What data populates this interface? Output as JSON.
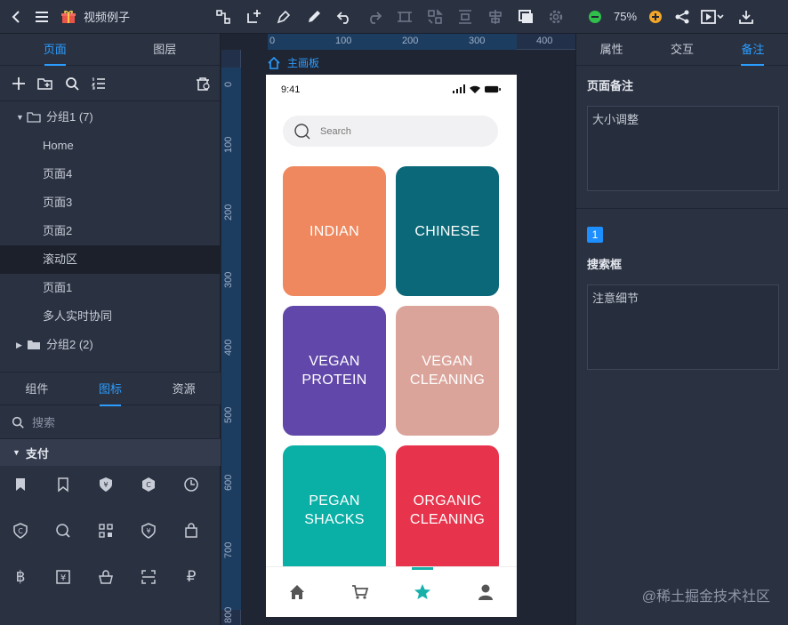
{
  "app": {
    "title": "视频例子",
    "zoom": "75%"
  },
  "left_panel": {
    "tabs": [
      "页面",
      "图层"
    ],
    "tree": [
      {
        "label": "分组1 (7)",
        "type": "group",
        "expanded": true
      },
      {
        "label": "Home",
        "type": "page"
      },
      {
        "label": "页面4",
        "type": "page"
      },
      {
        "label": "页面3",
        "type": "page"
      },
      {
        "label": "页面2",
        "type": "page"
      },
      {
        "label": "滚动区",
        "type": "page",
        "selected": true
      },
      {
        "label": "页面1",
        "type": "page"
      },
      {
        "label": "多人实时协同",
        "type": "page"
      },
      {
        "label": "分组2 (2)",
        "type": "group",
        "expanded": false
      }
    ],
    "lib_tabs": [
      "组件",
      "图标",
      "资源"
    ],
    "search_placeholder": "搜索",
    "category": "支付"
  },
  "canvas": {
    "ruler_marks": [
      "0",
      "100",
      "200",
      "300",
      "400"
    ],
    "ruler_v_marks": [
      "0",
      "100",
      "200",
      "300",
      "400",
      "500",
      "600",
      "700",
      "800"
    ],
    "board_label": "主画板"
  },
  "phone": {
    "time": "9:41",
    "search_placeholder": "Search",
    "tiles": [
      {
        "line1": "INDIAN",
        "line2": "",
        "color": "#ef885e"
      },
      {
        "line1": "CHINESE",
        "line2": "",
        "color": "#0a6878"
      },
      {
        "line1": "VEGAN",
        "line2": "PROTEIN",
        "color": "#6047a9"
      },
      {
        "line1": "VEGAN",
        "line2": "CLEANING",
        "color": "#dba49b"
      },
      {
        "line1": "PEGAN",
        "line2": "SHACKS",
        "color": "#0ab0a6"
      },
      {
        "line1": "ORGANIC",
        "line2": "CLEANING",
        "color": "#e7334b"
      }
    ],
    "tabbar_active_color": "#18b1aa"
  },
  "right_panel": {
    "tabs": [
      "属性",
      "交互",
      "备注"
    ],
    "page_note_title": "页面备注",
    "page_note_text": "大小调整",
    "badge": "1",
    "element_title": "搜索框",
    "element_note_text": "注意细节"
  },
  "watermark": "@稀土掘金技术社区"
}
